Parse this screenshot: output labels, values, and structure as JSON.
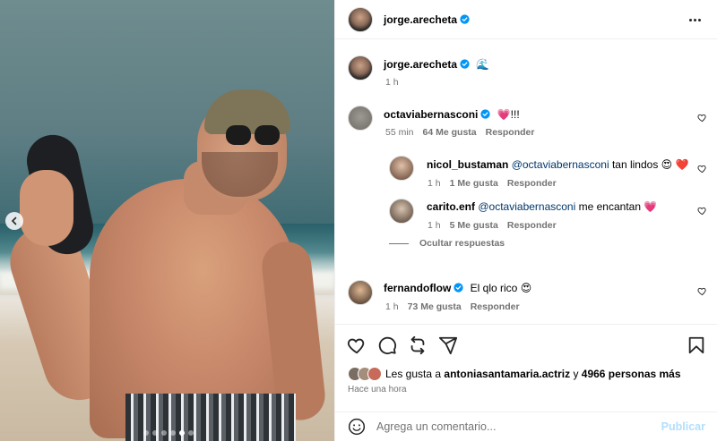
{
  "post": {
    "author": "jorge.arecheta",
    "caption_author": "jorge.arecheta",
    "caption_emoji": "🌊",
    "caption_time": "1 h"
  },
  "comments": [
    {
      "user": "octaviabernasconi",
      "verified": true,
      "text": "💗!!!",
      "time": "55 min",
      "likes": "64 Me gusta",
      "reply": "Responder"
    },
    {
      "user": "nicol_bustaman",
      "verified": false,
      "mention": "@octaviabernasconi",
      "text": " tan lindos 😍 ❤️",
      "time": "1 h",
      "likes": "1 Me gusta",
      "reply": "Responder"
    },
    {
      "user": "carito.enf",
      "verified": false,
      "mention": "@octaviabernasconi",
      "text": " me encantan 💗",
      "time": "1 h",
      "likes": "5 Me gusta",
      "reply": "Responder"
    },
    {
      "user": "fernandoflow",
      "verified": true,
      "text": "El qlo rico 😍",
      "time": "1 h",
      "likes": "73 Me gusta",
      "reply": "Responder"
    }
  ],
  "hide_replies": "Ocultar respuestas",
  "likes": {
    "prefix": "Les gusta a ",
    "user": "antoniasantamaria.actriz",
    "middle": " y ",
    "count": "4966 personas más"
  },
  "time_ago": "Hace una hora",
  "comment_box": {
    "placeholder": "Agrega un comentario...",
    "publish": "Publicar"
  },
  "colors": {
    "verified": "#0095f6",
    "mention": "#00376b",
    "publish": "#b2dffc"
  }
}
